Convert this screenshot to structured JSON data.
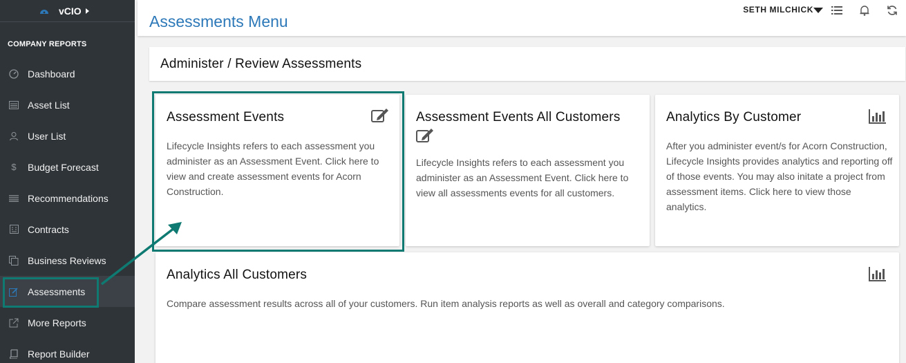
{
  "sidebar": {
    "brand": "vCIO",
    "section": "COMPANY REPORTS",
    "items": [
      {
        "label": "Dashboard",
        "icon": "gauge-icon"
      },
      {
        "label": "Asset List",
        "icon": "list-icon"
      },
      {
        "label": "User List",
        "icon": "user-icon"
      },
      {
        "label": "Budget Forecast",
        "icon": "dollar-icon"
      },
      {
        "label": "Recommendations",
        "icon": "lines-icon"
      },
      {
        "label": "Contracts",
        "icon": "contract-icon"
      },
      {
        "label": "Business Reviews",
        "icon": "copy-icon"
      },
      {
        "label": "Assessments",
        "icon": "edit-icon"
      },
      {
        "label": "More Reports",
        "icon": "external-link-icon"
      },
      {
        "label": "Report Builder",
        "icon": "book-icon"
      }
    ],
    "active_item": "Assessments"
  },
  "header": {
    "title": "Assessments Menu",
    "user": "SETH MILCHICK"
  },
  "section": {
    "title": "Administer / Review Assessments"
  },
  "cards": [
    {
      "title": "Assessment Events",
      "description": "Lifecycle Insights refers to each assessment you administer as an Assessment Event. Click here to view and create assessment events for Acorn Construction.",
      "icon": "edit-icon"
    },
    {
      "title": "Assessment Events All Customers",
      "description": "Lifecycle Insights refers to each assessment you administer as an Assessment Event. Click here to view all assessments events for all customers.",
      "icon": "edit-icon"
    },
    {
      "title": "Analytics By Customer",
      "description": "After you administer event/s for Acorn Construction, Lifecycle Insights provides analytics and reporting off of those events. You may also initate a project from assessment items. Click here to view those analytics.",
      "icon": "bar-chart-icon"
    },
    {
      "title": "Analytics All Customers",
      "description": "Compare assessment results across all of your customers. Run item analysis reports as well as overall and category comparisons.",
      "icon": "bar-chart-icon"
    }
  ],
  "colors": {
    "accent_blue": "#2c78b8",
    "highlight_teal": "#0e7a72",
    "sidebar_bg": "#2f3438"
  }
}
